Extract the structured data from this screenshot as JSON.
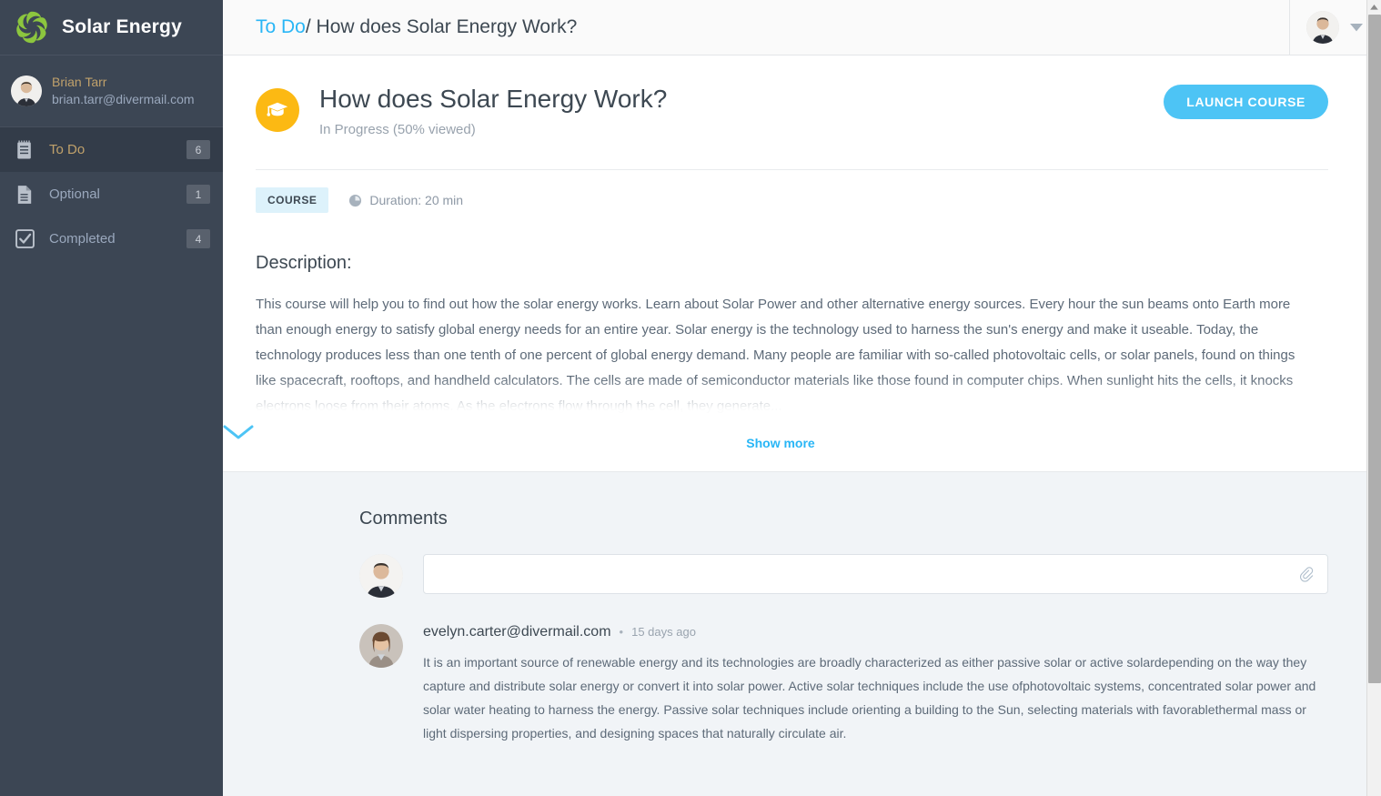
{
  "brand": {
    "name": "Solar Energy",
    "logo_icon": "solar-pinwheel-logo",
    "logo_color": "#8cc63e"
  },
  "sidebar": {
    "user": {
      "name": "Brian Tarr",
      "email": "brian.tarr@divermail.com",
      "avatar_icon": "user-avatar"
    },
    "items": [
      {
        "label": "To Do",
        "badge": "6",
        "icon": "notepad-icon",
        "active": true
      },
      {
        "label": "Optional",
        "badge": "1",
        "icon": "document-icon",
        "active": false
      },
      {
        "label": "Completed",
        "badge": "4",
        "icon": "checkbox-checked-icon",
        "active": false
      }
    ]
  },
  "topbar": {
    "breadcrumb_root": "To Do",
    "breadcrumb_separator": "/",
    "breadcrumb_current": "How does Solar Energy Work?",
    "profile_avatar_icon": "profile-avatar",
    "profile_chevron_icon": "chevron-down-icon"
  },
  "course": {
    "icon": "graduation-cap-icon",
    "icon_color": "#fcb913",
    "title": "How does Solar Energy Work?",
    "status": "In Progress (50% viewed)",
    "launch_label": "LAUNCH COURSE",
    "launch_color": "#4dc4f5",
    "type_chip": "COURSE",
    "duration_icon": "clock-icon",
    "duration": "Duration: 20 min",
    "description_heading": "Description:",
    "description": "This course will help you to find out how the solar energy works. Learn about Solar Power and other alternative energy sources. Every hour the sun beams onto Earth more than enough energy to satisfy global energy needs for an entire year. Solar energy is the technology used to harness the sun's energy and make it useable. Today, the technology produces less than one tenth of one percent of global energy demand. Many people are familiar with so-called photovoltaic cells, or solar panels, found on things like spacecraft, rooftops, and handheld calculators. The cells are made of semiconductor materials like those found in computer chips. When sunlight hits the cells, it knocks electrons loose from their atoms. As the electrons flow through the cell, they generate...",
    "show_more_label": "Show more",
    "show_more_icon": "chevron-down-icon"
  },
  "comments": {
    "heading": "Comments",
    "compose": {
      "value": "",
      "placeholder": "",
      "avatar_icon": "user-avatar",
      "attach_icon": "paperclip-icon"
    },
    "list": [
      {
        "author": "evelyn.carter@divermail.com",
        "separator": "•",
        "time": "15 days ago",
        "avatar_icon": "user-avatar",
        "text": "It is an important source of renewable energy and its technologies are broadly characterized as either passive solar or active solardepending on the way they capture and distribute solar energy or convert it into solar power. Active solar techniques include the use ofphotovoltaic systems, concentrated solar power and solar water heating to harness the energy. Passive solar techniques include orienting a building to the Sun, selecting materials with favorablethermal mass or light dispersing properties, and designing spaces that naturally circulate air."
      }
    ]
  },
  "scrollbar": {
    "up_icon": "scroll-up-arrow-icon",
    "thumb": "scroll-thumb"
  }
}
